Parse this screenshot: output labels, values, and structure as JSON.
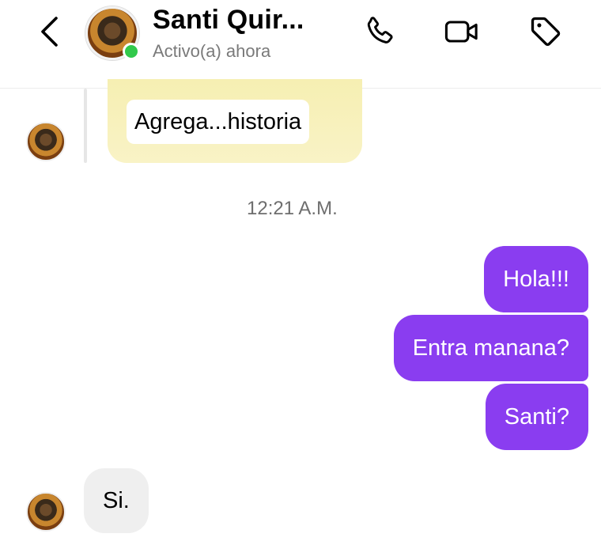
{
  "header": {
    "back_icon": "chevron-left-icon",
    "contact_name": "Santi Quir...",
    "status": "Activo(a) ahora",
    "online_color": "#31c94b",
    "actions": [
      {
        "name": "call-button",
        "icon": "phone-icon"
      },
      {
        "name": "video-call-button",
        "icon": "video-camera-icon"
      },
      {
        "name": "tag-button",
        "icon": "tag-icon"
      }
    ]
  },
  "conversation": {
    "story_reply": {
      "label": "Agrega...historia",
      "card_color": "#f6efb2"
    },
    "timestamp": "12:21 A.M.",
    "outgoing_messages": [
      "Hola!!!",
      "Entra manana?",
      "Santi?"
    ],
    "outgoing_color": "#8a3df0",
    "incoming_message": "Si.",
    "incoming_color": "#efefef"
  }
}
